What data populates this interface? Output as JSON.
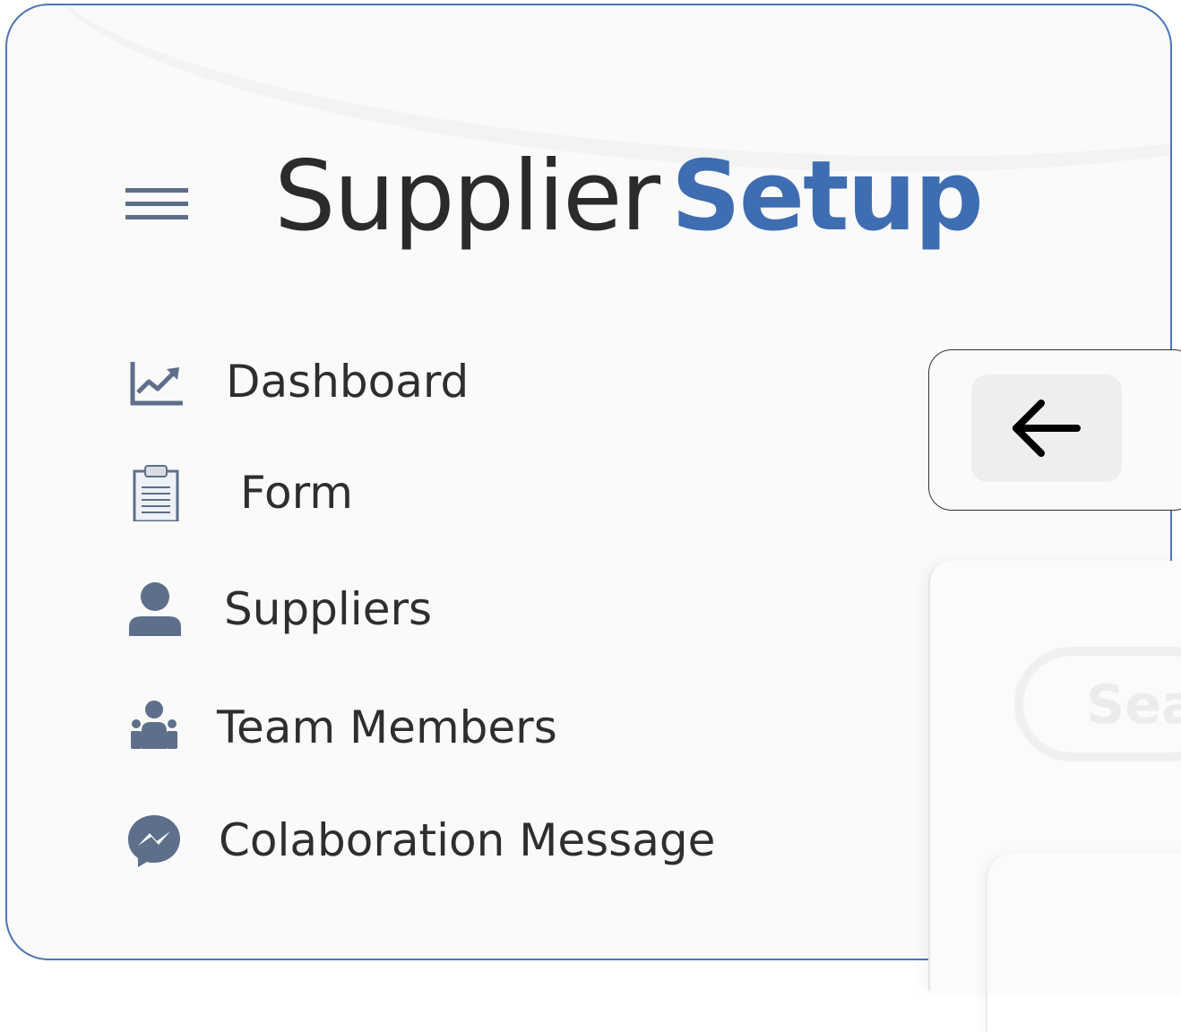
{
  "header": {
    "title_part1": "Supplier",
    "title_part2": "Setup",
    "menu_icon": "hamburger-icon"
  },
  "sidebar": {
    "items": [
      {
        "label": "Dashboard",
        "icon": "chart-line-icon"
      },
      {
        "label": "Form",
        "icon": "clipboard-icon"
      },
      {
        "label": "Suppliers",
        "icon": "user-icon"
      },
      {
        "label": "Team Members",
        "icon": "team-icon"
      },
      {
        "label": "Colaboration Message",
        "icon": "messenger-icon"
      }
    ]
  },
  "main": {
    "back_button_icon": "arrow-left-icon",
    "search_placeholder_visible": "Sea"
  },
  "colors": {
    "accent": "#3f6db1",
    "icon": "#5d6f8a",
    "text": "#2e2e2e",
    "border": "#4a76b8"
  }
}
